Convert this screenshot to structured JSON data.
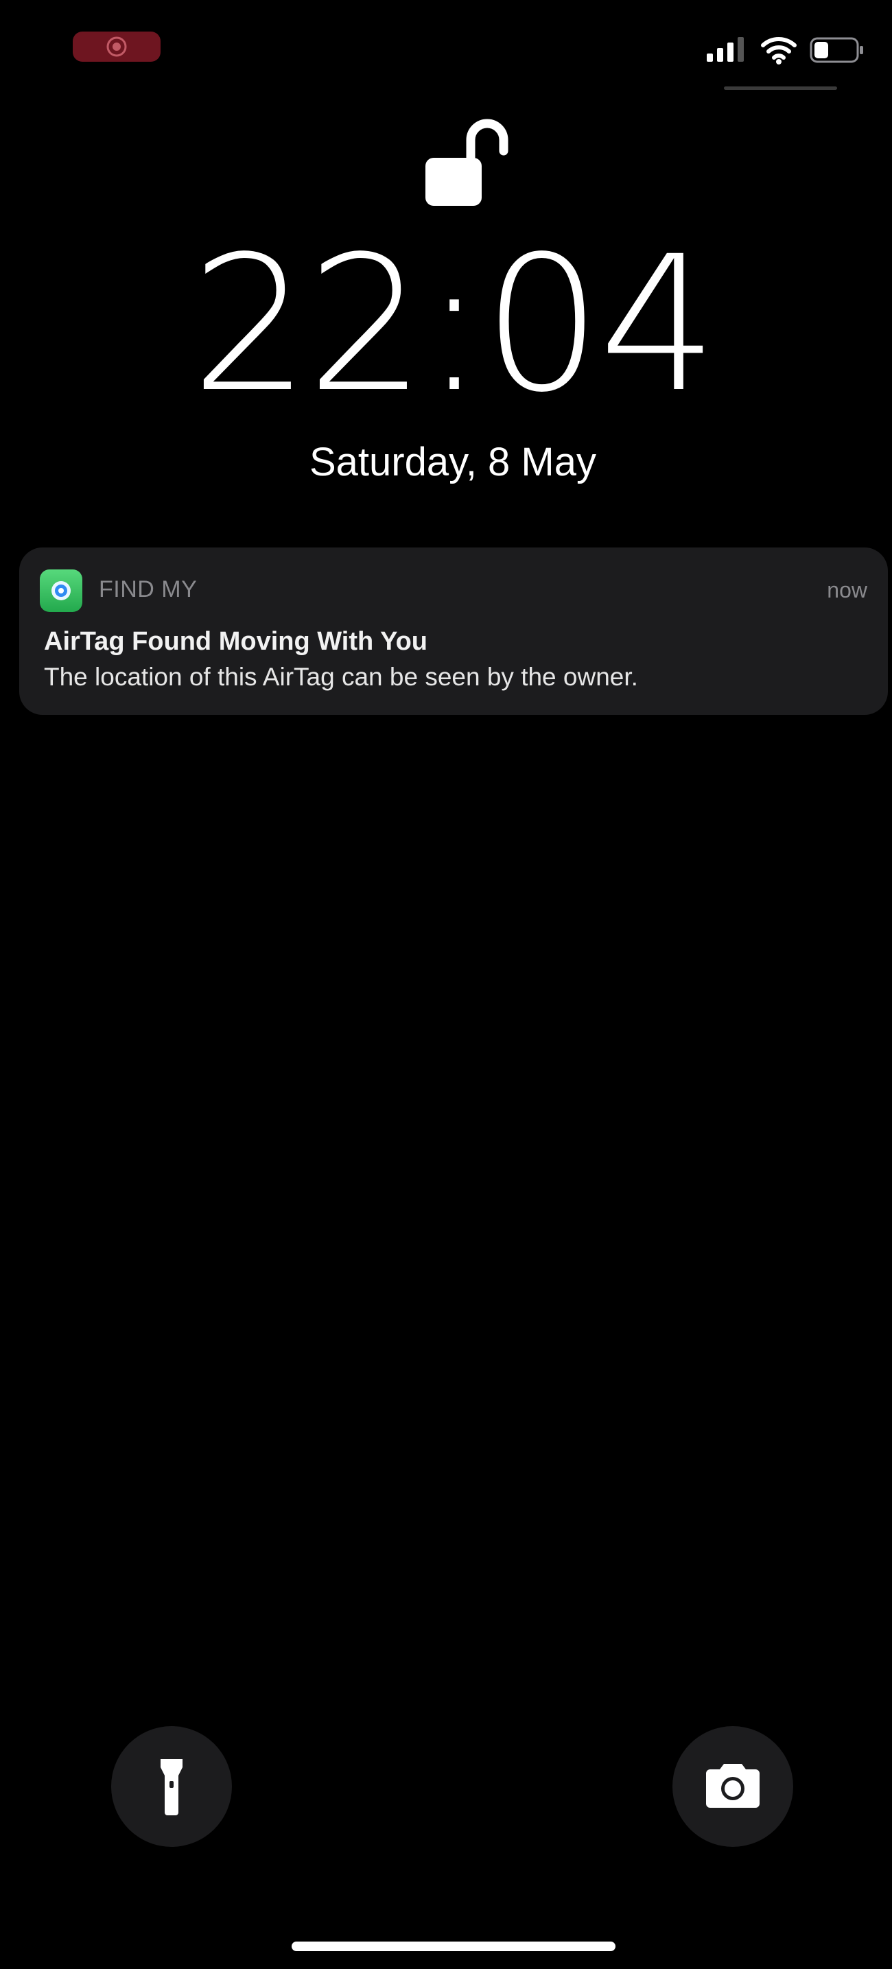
{
  "status_bar": {
    "recording_icon": "screen-record-icon",
    "signal_icon": "cellular-signal-icon",
    "wifi_icon": "wifi-icon",
    "battery_icon": "battery-icon",
    "recording_color": "#6e1520"
  },
  "lock": {
    "icon": "unlocked-padlock-icon"
  },
  "clock": {
    "time": "22:04",
    "date": "Saturday, 8 May"
  },
  "notification": {
    "app_icon": "find-my-app-icon",
    "app_name": "FIND MY",
    "time": "now",
    "title": "AirTag Found Moving With You",
    "body": "The location of this AirTag can be seen by the owner.",
    "icon_color": "#34c759"
  },
  "controls": {
    "flashlight_icon": "flashlight-icon",
    "camera_icon": "camera-icon"
  }
}
